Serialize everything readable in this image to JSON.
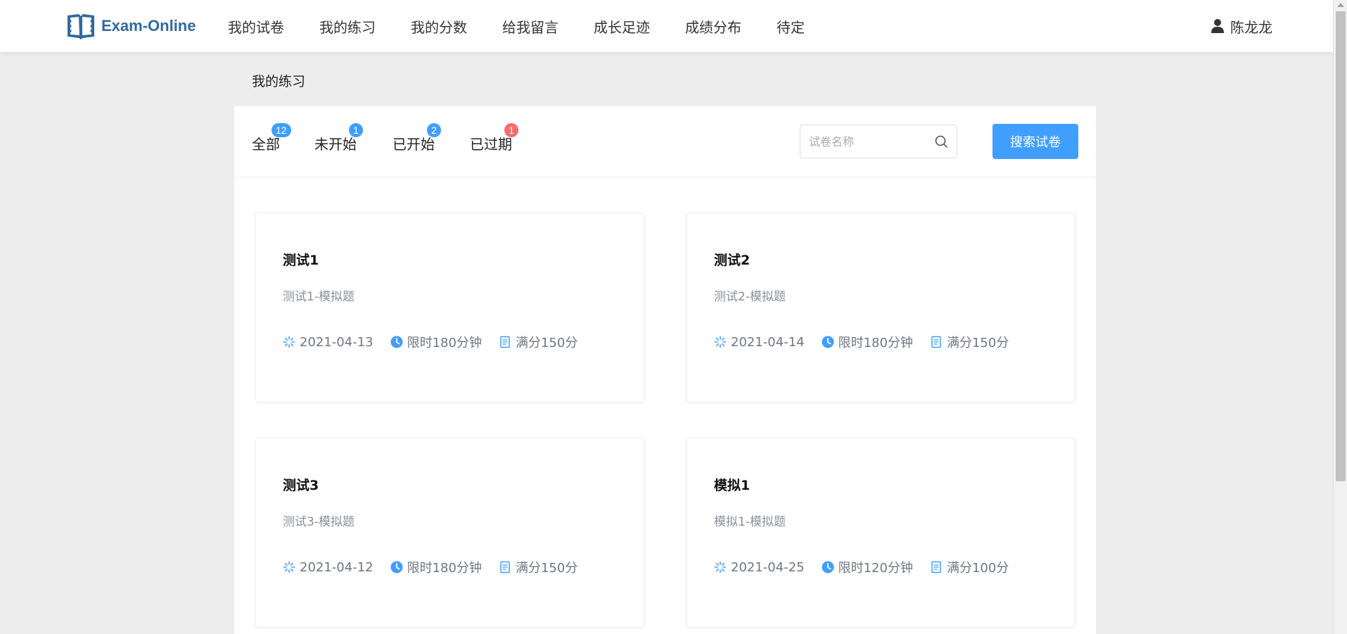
{
  "app": {
    "logo_text": "Exam-Online"
  },
  "nav": {
    "items": [
      "我的试卷",
      "我的练习",
      "我的分数",
      "给我留言",
      "成长足迹",
      "成绩分布",
      "待定"
    ]
  },
  "user": {
    "name": "陈龙龙"
  },
  "page": {
    "title": "我的练习"
  },
  "filters": {
    "tabs": [
      {
        "label": "全部",
        "count": "12",
        "badge_type": "primary"
      },
      {
        "label": "未开始",
        "count": "1",
        "badge_type": "primary"
      },
      {
        "label": "已开始",
        "count": "2",
        "badge_type": "primary"
      },
      {
        "label": "已过期",
        "count": "1",
        "badge_type": "danger"
      }
    ],
    "search_placeholder": "试卷名称",
    "search_value": "",
    "search_button": "搜索试卷"
  },
  "cards": [
    {
      "title": "测试1",
      "desc": "测试1-模拟题",
      "date": "2021-04-13",
      "time_limit": "限时180分钟",
      "full_score": "满分150分"
    },
    {
      "title": "测试2",
      "desc": "测试2-模拟题",
      "date": "2021-04-14",
      "time_limit": "限时180分钟",
      "full_score": "满分150分"
    },
    {
      "title": "测试3",
      "desc": "测试3-模拟题",
      "date": "2021-04-12",
      "time_limit": "限时180分钟",
      "full_score": "满分150分"
    },
    {
      "title": "模拟1",
      "desc": "模拟1-模拟题",
      "date": "2021-04-25",
      "time_limit": "限时120分钟",
      "full_score": "满分100分"
    }
  ],
  "colors": {
    "primary": "#409eff",
    "danger": "#f56c6c",
    "brand": "#2f6aa0"
  },
  "icons": {
    "logo": "open-book-icon",
    "user": "user-icon",
    "search": "search-icon",
    "date": "loading-icon",
    "time": "clock-icon",
    "score": "document-icon"
  }
}
